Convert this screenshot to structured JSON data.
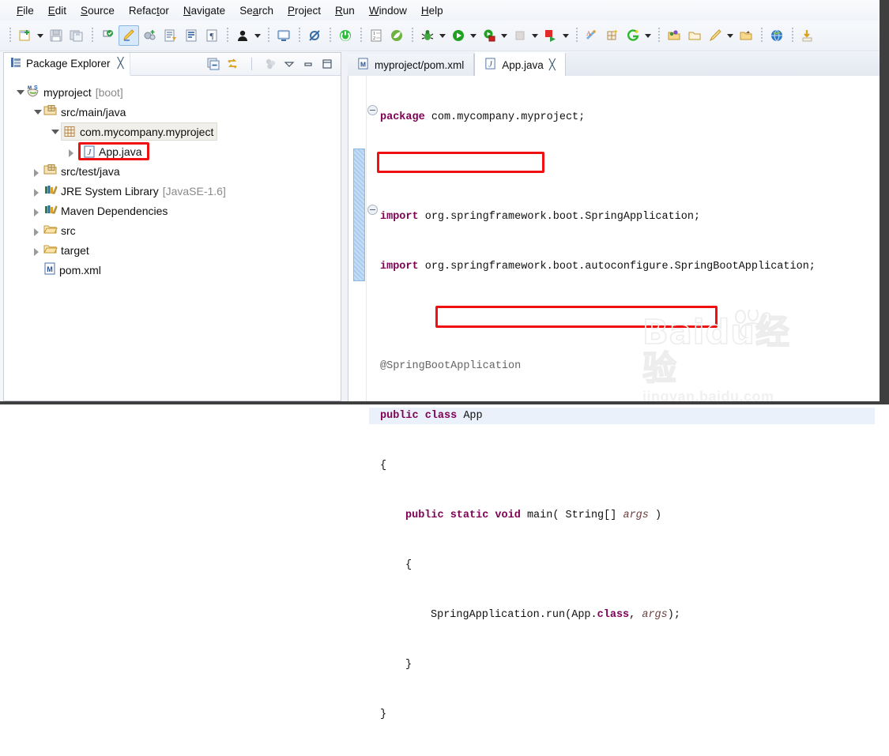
{
  "menu": {
    "items": [
      {
        "label": "File",
        "accel": "F"
      },
      {
        "label": "Edit",
        "accel": "E"
      },
      {
        "label": "Source",
        "accel": "S"
      },
      {
        "label": "Refactor",
        "accel": "t"
      },
      {
        "label": "Navigate",
        "accel": "N"
      },
      {
        "label": "Search",
        "accel": "a"
      },
      {
        "label": "Project",
        "accel": "P"
      },
      {
        "label": "Run",
        "accel": "R"
      },
      {
        "label": "Window",
        "accel": "W"
      },
      {
        "label": "Help",
        "accel": "H"
      }
    ]
  },
  "toolbar": {
    "groups": [
      {
        "buttons": [
          {
            "name": "new-wizard-icon",
            "tip": "New"
          },
          {
            "name": "dropdown-arrow-icon",
            "tip": "New menu"
          },
          {
            "name": "save-icon",
            "tip": "Save"
          },
          {
            "name": "save-all-icon",
            "tip": "Save All"
          }
        ]
      },
      {
        "buttons": [
          {
            "name": "print-icon",
            "tip": "Print"
          },
          {
            "name": "highlight-pen-icon",
            "tip": "Toggle Mark Occurrences",
            "active": true
          },
          {
            "name": "build-all-icon",
            "tip": "Build All"
          },
          {
            "name": "open-type-icon",
            "tip": "Open Type"
          },
          {
            "name": "open-task-icon",
            "tip": "Open Task"
          },
          {
            "name": "paragraph-icon",
            "tip": "Show Whitespace"
          }
        ]
      },
      {
        "buttons": [
          {
            "name": "person-icon",
            "tip": "Open Perspective"
          },
          {
            "name": "dropdown-arrow-icon",
            "tip": "Perspective menu"
          }
        ]
      },
      {
        "buttons": [
          {
            "name": "console-icon",
            "tip": "Open Console"
          }
        ]
      },
      {
        "buttons": [
          {
            "name": "skip-breakpoints-icon",
            "tip": "Skip All Breakpoints"
          }
        ]
      },
      {
        "buttons": [
          {
            "name": "power-icon",
            "tip": "Boot Dashboard"
          }
        ]
      },
      {
        "buttons": [
          {
            "name": "list-numbers-icon",
            "tip": "Open Task List"
          },
          {
            "name": "spring-leaf-icon",
            "tip": "Spring Tools"
          }
        ]
      },
      {
        "buttons": [
          {
            "name": "debug-bug-icon",
            "tip": "Debug"
          },
          {
            "name": "dropdown-arrow-icon",
            "tip": "Debug menu"
          },
          {
            "name": "run-icon",
            "tip": "Run"
          },
          {
            "name": "dropdown-arrow-icon",
            "tip": "Run menu"
          },
          {
            "name": "run-external-icon",
            "tip": "External Tools"
          },
          {
            "name": "dropdown-arrow-icon",
            "tip": "External Tools menu"
          },
          {
            "name": "stop-icon",
            "tip": "Terminate",
            "disabled": true
          },
          {
            "name": "dropdown-arrow-icon",
            "tip": "Stop menu"
          },
          {
            "name": "coverage-icon",
            "tip": "Coverage"
          },
          {
            "name": "dropdown-arrow-icon",
            "tip": "Coverage menu"
          }
        ]
      },
      {
        "buttons": [
          {
            "name": "new-java-class-icon",
            "tip": "New Java Class"
          },
          {
            "name": "new-package-icon",
            "tip": "New Java Package"
          },
          {
            "name": "git-icon",
            "tip": "Git"
          },
          {
            "name": "dropdown-arrow-icon",
            "tip": "Git menu"
          }
        ]
      },
      {
        "buttons": [
          {
            "name": "open-resource-icon",
            "tip": "Open Resource"
          },
          {
            "name": "previous-edit-icon",
            "tip": "Last Edit Location"
          },
          {
            "name": "next-annotation-icon",
            "tip": "Next Annotation"
          },
          {
            "name": "dropdown-arrow-icon",
            "tip": "Annotation menu"
          },
          {
            "name": "back-icon",
            "tip": "Back"
          }
        ]
      },
      {
        "buttons": [
          {
            "name": "globe-icon",
            "tip": "Open Web Browser"
          }
        ]
      },
      {
        "buttons": [
          {
            "name": "download-icon",
            "tip": "Download"
          }
        ]
      }
    ]
  },
  "package_explorer": {
    "title": "Package Explorer",
    "close_glyph": "╳",
    "view_buttons": [
      {
        "name": "collapse-all-icon",
        "tip": "Collapse All"
      },
      {
        "name": "link-with-editor-icon",
        "tip": "Link with Editor"
      },
      {
        "name": "focus-on-active-task-icon",
        "tip": "Focus on Active Task",
        "disabled": true
      },
      {
        "name": "view-menu-icon",
        "tip": "View Menu"
      },
      {
        "name": "minimize-icon",
        "tip": "Minimize"
      },
      {
        "name": "maximize-icon",
        "tip": "Maximize"
      }
    ],
    "tree": [
      {
        "label": "myproject",
        "suffix": "[boot]",
        "icon": "maven-spring-project-icon",
        "indent": 0,
        "twisty": "open"
      },
      {
        "label": "src/main/java",
        "suffix": "",
        "icon": "source-folder-icon",
        "indent": 1,
        "twisty": "open"
      },
      {
        "label": "com.mycompany.myproject",
        "suffix": "",
        "icon": "package-icon",
        "indent": 2,
        "twisty": "open",
        "selected": true
      },
      {
        "label": "App.java",
        "suffix": "",
        "icon": "java-file-icon",
        "indent": 3,
        "twisty": "closed",
        "highlighted": true
      },
      {
        "label": "src/test/java",
        "suffix": "",
        "icon": "source-folder-icon",
        "indent": 1,
        "twisty": "closed"
      },
      {
        "label": "JRE System Library",
        "suffix": "[JavaSE-1.6]",
        "icon": "library-icon",
        "indent": 1,
        "twisty": "closed"
      },
      {
        "label": "Maven Dependencies",
        "suffix": "",
        "icon": "library-icon",
        "indent": 1,
        "twisty": "closed"
      },
      {
        "label": "src",
        "suffix": "",
        "icon": "folder-icon",
        "indent": 1,
        "twisty": "closed"
      },
      {
        "label": "target",
        "suffix": "",
        "icon": "folder-icon",
        "indent": 1,
        "twisty": "closed"
      },
      {
        "label": "pom.xml",
        "suffix": "",
        "icon": "maven-pom-icon",
        "indent": 1,
        "twisty": "none"
      }
    ]
  },
  "editor": {
    "tabs": [
      {
        "label": "myproject/pom.xml",
        "icon": "maven-pom-icon",
        "active": false,
        "close_glyph": ""
      },
      {
        "label": "App.java",
        "icon": "java-file-icon",
        "active": true,
        "close_glyph": "╳"
      }
    ],
    "code_lines": [
      {
        "segments": [
          {
            "t": "package ",
            "c": "kw"
          },
          {
            "t": "com.mycompany.myproject;",
            "c": ""
          }
        ],
        "indent": 0
      },
      {
        "segments": [],
        "indent": 0
      },
      {
        "segments": [
          {
            "t": "import ",
            "c": "kw"
          },
          {
            "t": "org.springframework.boot.SpringApplication;",
            "c": ""
          }
        ],
        "indent": 0,
        "fold": true
      },
      {
        "segments": [
          {
            "t": "import ",
            "c": "kw"
          },
          {
            "t": "org.springframework.boot.autoconfigure.SpringBootApplication;",
            "c": ""
          }
        ],
        "indent": 0
      },
      {
        "segments": [],
        "indent": 0
      },
      {
        "segments": [
          {
            "t": "@SpringBootApplication",
            "c": "ann"
          }
        ],
        "indent": 0,
        "boxed": true
      },
      {
        "segments": [
          {
            "t": "public class ",
            "c": "kw"
          },
          {
            "t": "App",
            "c": ""
          }
        ],
        "indent": 0,
        "current": true
      },
      {
        "segments": [
          {
            "t": "{",
            "c": ""
          }
        ],
        "indent": 0
      },
      {
        "segments": [
          {
            "t": "public static void ",
            "c": "kw"
          },
          {
            "t": "main( ",
            "c": ""
          },
          {
            "t": "String",
            "c": ""
          },
          {
            "t": "[] ",
            "c": ""
          },
          {
            "t": "args",
            "c": "prm"
          },
          {
            "t": " )",
            "c": ""
          }
        ],
        "indent": 1,
        "fold": true
      },
      {
        "segments": [
          {
            "t": "{",
            "c": ""
          }
        ],
        "indent": 1
      },
      {
        "segments": [
          {
            "t": "SpringApplication.run(App.",
            "c": ""
          },
          {
            "t": "class",
            "c": "kw"
          },
          {
            "t": ", ",
            "c": ""
          },
          {
            "t": "args",
            "c": "prm"
          },
          {
            "t": ");",
            "c": ""
          }
        ],
        "indent": 2,
        "boxed": true
      },
      {
        "segments": [
          {
            "t": "}",
            "c": ""
          }
        ],
        "indent": 1
      },
      {
        "segments": [
          {
            "t": "}",
            "c": ""
          }
        ],
        "indent": 0
      }
    ]
  },
  "watermark": {
    "brand": "Bai",
    "brand2": "du",
    "cn": "经验",
    "url": "jingyan.baidu.com"
  },
  "colors": {
    "annotation_box": "#ef1111",
    "keyword": "#7f0055",
    "parameter": "#6a3e3e",
    "annotation_text": "#646464",
    "changebar": "#a9cdf0",
    "selection": "#f0efe9"
  }
}
